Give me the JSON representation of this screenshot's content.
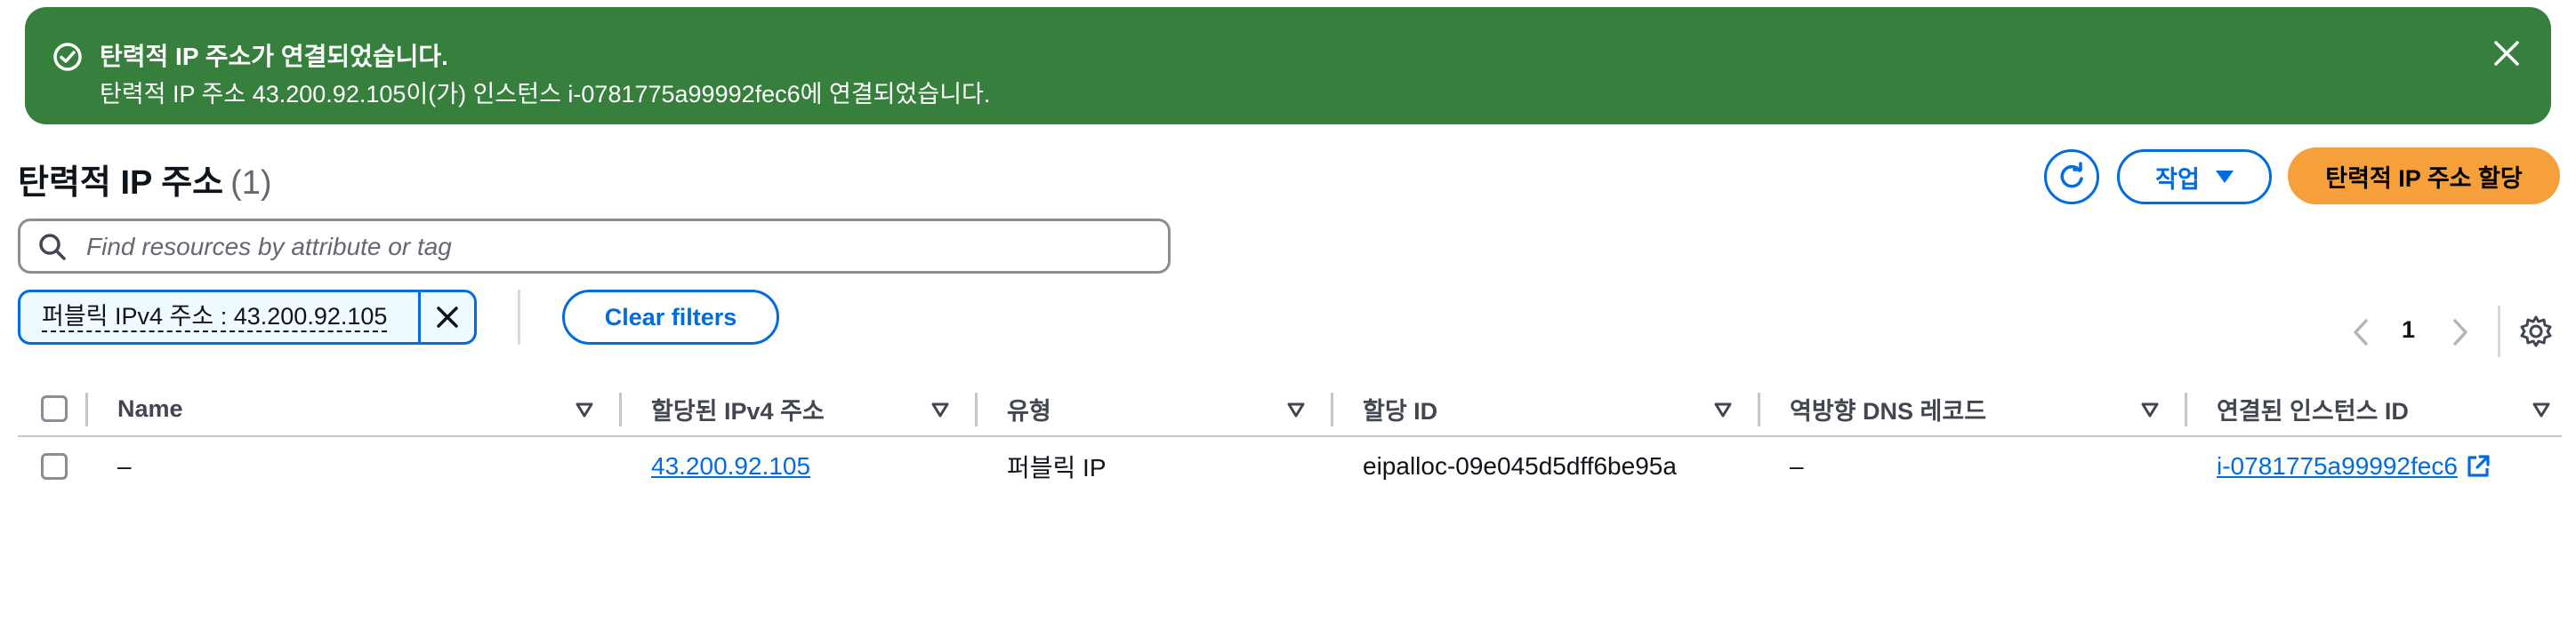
{
  "flash": {
    "title": "탄력적 IP 주소가 연결되었습니다.",
    "message": "탄력적 IP 주소 43.200.92.105이(가) 인스턴스 i-0781775a99992fec6에 연결되었습니다.",
    "color": "#377f3d"
  },
  "header": {
    "title": "탄력적 IP 주소",
    "count": "(1)",
    "actions_label": "작업",
    "allocate_label": "탄력적 IP 주소 할당"
  },
  "search": {
    "placeholder": "Find resources by attribute or tag"
  },
  "filter": {
    "token_label": "퍼블릭 IPv4 주소 : 43.200.92.105",
    "clear_label": "Clear filters"
  },
  "pagination": {
    "current_page": "1"
  },
  "table": {
    "columns": [
      "Name",
      "할당된 IPv4 주소",
      "유형",
      "할당 ID",
      "역방향 DNS 레코드",
      "연결된 인스턴스 ID"
    ],
    "rows": [
      {
        "name": "–",
        "ipv4": "43.200.92.105",
        "type": "퍼블릭 IP",
        "allocation_id": "eipalloc-09e045d5dff6be95a",
        "reverse_dns": "–",
        "instance_id": "i-0781775a99992fec6"
      }
    ]
  },
  "colors": {
    "accent": "#006ce0",
    "primary_button": "#f5a03a",
    "success": "#377f3d"
  },
  "icons": [
    "success-check-icon",
    "close-icon",
    "refresh-icon",
    "caret-down-icon",
    "search-icon",
    "remove-filter-icon",
    "chevron-left-icon",
    "chevron-right-icon",
    "settings-icon",
    "sort-icon",
    "external-link-icon"
  ]
}
